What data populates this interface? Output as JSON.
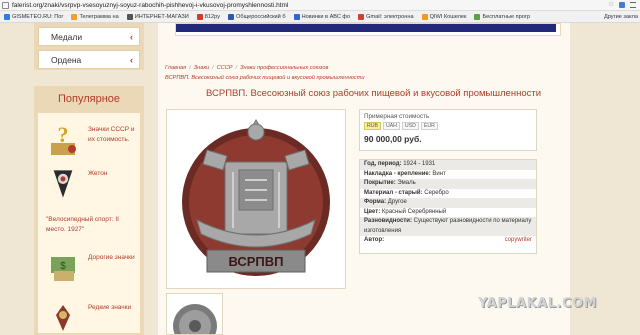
{
  "browser": {
    "url": "falerist.org/znaki/vsrpvp-vsesoyuznyj-soyuz-rabochih-pishhevoj-i-vkusovoj-promyshlennosti.html",
    "bookmarks": [
      {
        "label": "GISMETEO.RU: Пог",
        "color": "#2f7fd8"
      },
      {
        "label": "Телеграмма на",
        "color": "#f2a024"
      },
      {
        "label": "ИНТЕРНЕТ-МАГАЗИ",
        "color": "#555555"
      },
      {
        "label": "812py",
        "color": "#d83a2a"
      },
      {
        "label": "Общероссийский б",
        "color": "#2c5aa8"
      },
      {
        "label": "Новинки в АВС фо",
        "color": "#3366cc"
      },
      {
        "label": "Gmail: электронна",
        "color": "#d23f31"
      },
      {
        "label": "QIWI Кошелек",
        "color": "#f59b1c"
      },
      {
        "label": "Бесплатные прогр",
        "color": "#5aa33f"
      }
    ],
    "bookmarks_more": "Другие закла"
  },
  "sidebar": {
    "menu": [
      {
        "label": "Медали",
        "icon": "chevron-left-icon"
      },
      {
        "label": "Ордена",
        "icon": "chevron-left-icon"
      }
    ],
    "popular_title": "Популярное",
    "popular": [
      {
        "text": "Значки СССР и их стоимость.",
        "icon": "question-badge-icon"
      },
      {
        "text": "Жетон",
        "caption": "\"Велосипедный спорт: II место. 1927\"",
        "icon": "medal-token-icon"
      },
      {
        "text": "Дорогие значки",
        "icon": "money-badge-icon"
      },
      {
        "text": "Редкие значки",
        "icon": "rare-badge-icon"
      }
    ]
  },
  "main": {
    "breadcrumbs": [
      "Главная",
      "Знаки",
      "СССР",
      "Знаки профессиональных союзов"
    ],
    "subtitle": "ВСРПВП. Всесоюзный союз рабочих пищевой и вкусовой промышленности",
    "title": "ВСРПВП. Всесоюзный союз рабочих пищевой и вкусовой промышленности",
    "badge_inscription": "ВСРПВП",
    "price": {
      "label": "Примерная стоимость",
      "currencies": [
        "RUB",
        "UAH",
        "USD",
        "EUR"
      ],
      "active_currency": "RUB",
      "value": "90 000,00 руб."
    },
    "details": [
      {
        "key": "Год, период:",
        "value": "1924 - 1931"
      },
      {
        "key": "Накладка - крепление:",
        "value": "Винт"
      },
      {
        "key": "Покрытие:",
        "value": "Эмаль"
      },
      {
        "key": "Материал - старый:",
        "value": "Серебро"
      },
      {
        "key": "Форма:",
        "value": "Другое"
      },
      {
        "key": "Цвет:",
        "value": "Красный Серебрянный"
      },
      {
        "key": "Разновидности:",
        "value": "Существуют разновидности по материалу изготовления"
      },
      {
        "key": "Автор:",
        "value": "",
        "link": "copywriter"
      }
    ]
  },
  "watermark": "YAPLAKAL.COM"
}
